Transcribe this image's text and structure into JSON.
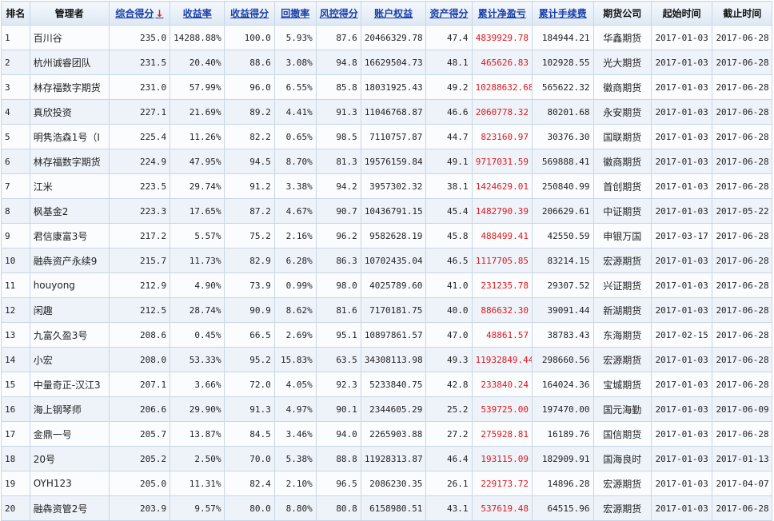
{
  "colors": {
    "header_link": "#1a3fa8",
    "sort_arrow": "#d7261e",
    "negative": "#e0161b",
    "row_alt": "#eef3fa",
    "border": "#c9d6e6"
  },
  "headers": {
    "rank": "排名",
    "manager": "管理者",
    "score": "综合得分",
    "score_arrow": "↓",
    "return_rate": "收益率",
    "return_score": "收益得分",
    "drawdown": "回撤率",
    "risk_score": "风控得分",
    "equity": "账户权益",
    "asset_score": "资产得分",
    "net_profit": "累计净盈亏",
    "fees": "累计手续费",
    "company": "期货公司",
    "start": "起始时间",
    "end": "截止时间"
  },
  "rows": [
    {
      "rank": "1",
      "manager": "百川谷",
      "score": "235.0",
      "return_rate": "14288.88%",
      "return_score": "100.0",
      "drawdown": "5.93%",
      "risk_score": "87.6",
      "equity": "20466329.78",
      "asset_score": "47.4",
      "net_profit": "4839929.78",
      "fees": "184944.21",
      "company": "华鑫期货",
      "start": "2017-01-03",
      "end": "2017-06-28"
    },
    {
      "rank": "2",
      "manager": "杭州诚睿团队",
      "score": "231.5",
      "return_rate": "20.40%",
      "return_score": "88.6",
      "drawdown": "3.08%",
      "risk_score": "94.8",
      "equity": "16629504.73",
      "asset_score": "48.1",
      "net_profit": "465626.83",
      "fees": "102928.55",
      "company": "光大期货",
      "start": "2017-01-03",
      "end": "2017-06-28"
    },
    {
      "rank": "3",
      "manager": "林存福数字期货",
      "score": "231.0",
      "return_rate": "57.99%",
      "return_score": "96.0",
      "drawdown": "6.55%",
      "risk_score": "85.8",
      "equity": "18031925.43",
      "asset_score": "49.2",
      "net_profit": "10288632.68",
      "fees": "565622.32",
      "company": "徽商期货",
      "start": "2017-01-03",
      "end": "2017-06-28"
    },
    {
      "rank": "4",
      "manager": "真欣投资",
      "score": "227.1",
      "return_rate": "21.69%",
      "return_score": "89.2",
      "drawdown": "4.41%",
      "risk_score": "91.3",
      "equity": "11046768.87",
      "asset_score": "46.6",
      "net_profit": "2060778.32",
      "fees": "80201.68",
      "company": "永安期货",
      "start": "2017-01-03",
      "end": "2017-06-28"
    },
    {
      "rank": "5",
      "manager": "明隽浩森1号（I",
      "score": "225.4",
      "return_rate": "11.26%",
      "return_score": "82.2",
      "drawdown": "0.65%",
      "risk_score": "98.5",
      "equity": "7110757.87",
      "asset_score": "44.7",
      "net_profit": "823160.97",
      "fees": "30376.30",
      "company": "国联期货",
      "start": "2017-01-03",
      "end": "2017-06-28"
    },
    {
      "rank": "6",
      "manager": "林存福数字期货",
      "score": "224.9",
      "return_rate": "47.95%",
      "return_score": "94.5",
      "drawdown": "8.70%",
      "risk_score": "81.3",
      "equity": "19576159.84",
      "asset_score": "49.1",
      "net_profit": "9717031.59",
      "fees": "569888.41",
      "company": "徽商期货",
      "start": "2017-01-03",
      "end": "2017-06-28"
    },
    {
      "rank": "7",
      "manager": "江米",
      "score": "223.5",
      "return_rate": "29.74%",
      "return_score": "91.2",
      "drawdown": "3.38%",
      "risk_score": "94.2",
      "equity": "3957302.32",
      "asset_score": "38.1",
      "net_profit": "1424629.01",
      "fees": "250840.99",
      "company": "首创期货",
      "start": "2017-01-03",
      "end": "2017-06-28"
    },
    {
      "rank": "8",
      "manager": "枫基金2",
      "score": "223.3",
      "return_rate": "17.65%",
      "return_score": "87.2",
      "drawdown": "4.67%",
      "risk_score": "90.7",
      "equity": "10436791.15",
      "asset_score": "45.4",
      "net_profit": "1482790.39",
      "fees": "206629.61",
      "company": "中证期货",
      "start": "2017-01-03",
      "end": "2017-05-22"
    },
    {
      "rank": "9",
      "manager": "君信康富3号",
      "score": "217.2",
      "return_rate": "5.57%",
      "return_score": "75.2",
      "drawdown": "2.16%",
      "risk_score": "96.2",
      "equity": "9582628.19",
      "asset_score": "45.8",
      "net_profit": "488499.41",
      "fees": "42550.59",
      "company": "申银万国",
      "start": "2017-03-17",
      "end": "2017-06-28"
    },
    {
      "rank": "10",
      "manager": "融犇资产永续9",
      "score": "215.7",
      "return_rate": "11.73%",
      "return_score": "82.9",
      "drawdown": "6.28%",
      "risk_score": "86.3",
      "equity": "10702435.04",
      "asset_score": "46.5",
      "net_profit": "1117705.85",
      "fees": "83214.15",
      "company": "宏源期货",
      "start": "2017-01-03",
      "end": "2017-06-28"
    },
    {
      "rank": "11",
      "manager": "houyong",
      "score": "212.9",
      "return_rate": "4.90%",
      "return_score": "73.9",
      "drawdown": "0.99%",
      "risk_score": "98.0",
      "equity": "4025789.60",
      "asset_score": "41.0",
      "net_profit": "231235.78",
      "fees": "29307.52",
      "company": "兴证期货",
      "start": "2017-01-03",
      "end": "2017-06-28"
    },
    {
      "rank": "12",
      "manager": "闲趣",
      "score": "212.5",
      "return_rate": "28.74%",
      "return_score": "90.9",
      "drawdown": "8.62%",
      "risk_score": "81.6",
      "equity": "7170181.75",
      "asset_score": "40.0",
      "net_profit": "886632.30",
      "fees": "39091.44",
      "company": "新湖期货",
      "start": "2017-01-03",
      "end": "2017-06-28"
    },
    {
      "rank": "13",
      "manager": "九富久盈3号",
      "score": "208.6",
      "return_rate": "0.45%",
      "return_score": "66.5",
      "drawdown": "2.69%",
      "risk_score": "95.1",
      "equity": "10897861.57",
      "asset_score": "47.0",
      "net_profit": "48861.57",
      "fees": "38783.43",
      "company": "东海期货",
      "start": "2017-02-15",
      "end": "2017-06-28"
    },
    {
      "rank": "14",
      "manager": "小宏",
      "score": "208.0",
      "return_rate": "53.33%",
      "return_score": "95.2",
      "drawdown": "15.83%",
      "risk_score": "63.5",
      "equity": "34308113.98",
      "asset_score": "49.3",
      "net_profit": "11932849.44",
      "fees": "298660.56",
      "company": "宏源期货",
      "start": "2017-01-03",
      "end": "2017-06-28"
    },
    {
      "rank": "15",
      "manager": "中量奇正-汉江3",
      "score": "207.1",
      "return_rate": "3.66%",
      "return_score": "72.0",
      "drawdown": "4.05%",
      "risk_score": "92.3",
      "equity": "5233840.75",
      "asset_score": "42.8",
      "net_profit": "233840.24",
      "fees": "164024.36",
      "company": "宝城期货",
      "start": "2017-01-03",
      "end": "2017-06-28"
    },
    {
      "rank": "16",
      "manager": "海上钢琴师",
      "score": "206.6",
      "return_rate": "29.90%",
      "return_score": "91.3",
      "drawdown": "4.97%",
      "risk_score": "90.1",
      "equity": "2344605.29",
      "asset_score": "25.2",
      "net_profit": "539725.00",
      "fees": "197470.00",
      "company": "国元海勤",
      "start": "2017-01-03",
      "end": "2017-06-09"
    },
    {
      "rank": "17",
      "manager": "金鼎一号",
      "score": "205.7",
      "return_rate": "13.87%",
      "return_score": "84.5",
      "drawdown": "3.46%",
      "risk_score": "94.0",
      "equity": "2265903.88",
      "asset_score": "27.2",
      "net_profit": "275928.81",
      "fees": "16189.76",
      "company": "国信期货",
      "start": "2017-01-03",
      "end": "2017-06-28"
    },
    {
      "rank": "18",
      "manager": "20号",
      "score": "205.2",
      "return_rate": "2.50%",
      "return_score": "70.0",
      "drawdown": "5.38%",
      "risk_score": "88.8",
      "equity": "11928313.87",
      "asset_score": "46.4",
      "net_profit": "193115.09",
      "fees": "182909.91",
      "company": "国海良时",
      "start": "2017-01-03",
      "end": "2017-01-13"
    },
    {
      "rank": "19",
      "manager": "OYH123",
      "score": "205.0",
      "return_rate": "11.31%",
      "return_score": "82.4",
      "drawdown": "2.10%",
      "risk_score": "96.5",
      "equity": "2086230.35",
      "asset_score": "26.1",
      "net_profit": "229173.72",
      "fees": "14896.28",
      "company": "宏源期货",
      "start": "2017-01-03",
      "end": "2017-04-07"
    },
    {
      "rank": "20",
      "manager": "融犇资管2号",
      "score": "203.9",
      "return_rate": "9.57%",
      "return_score": "80.0",
      "drawdown": "8.80%",
      "risk_score": "80.8",
      "equity": "6158980.51",
      "asset_score": "43.1",
      "net_profit": "537619.48",
      "fees": "64515.96",
      "company": "宏源期货",
      "start": "2017-01-03",
      "end": "2017-06-28"
    }
  ]
}
